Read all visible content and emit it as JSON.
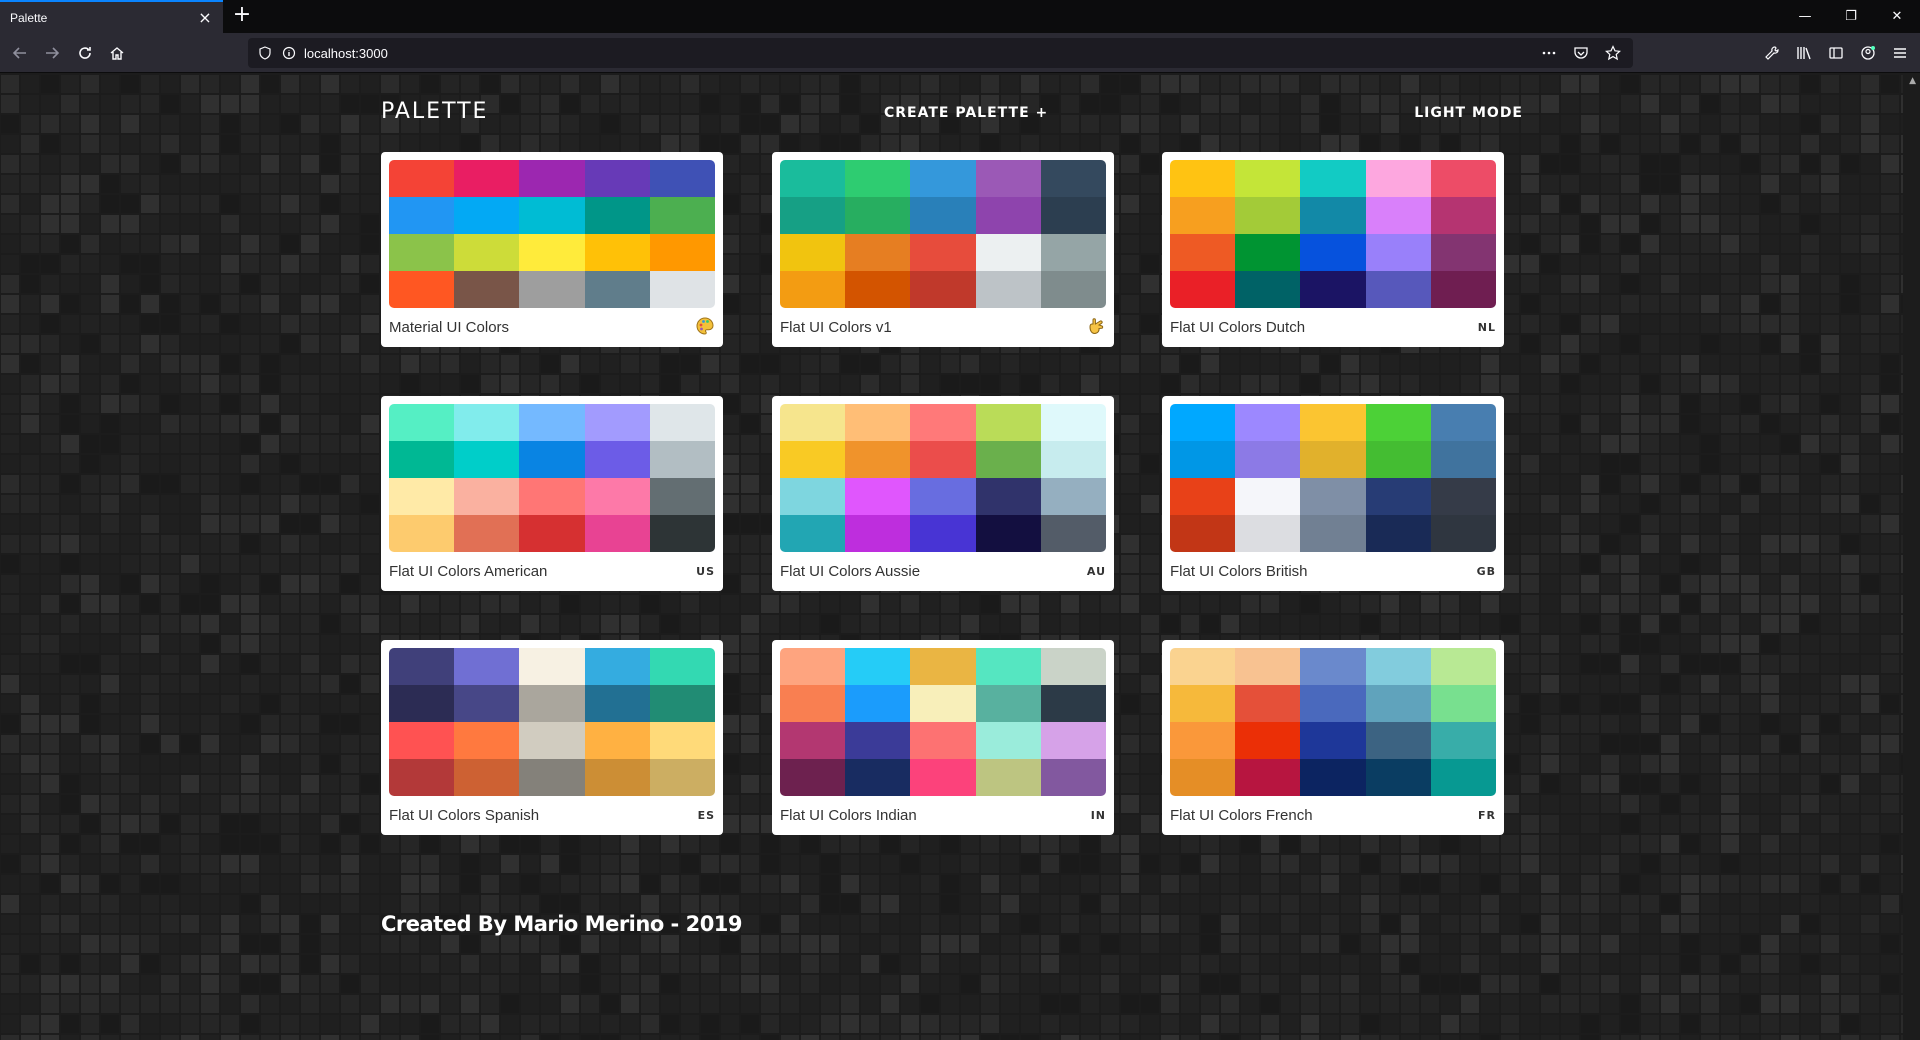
{
  "browser": {
    "tab_title": "Palette",
    "tab_close": "×",
    "new_tab": "+",
    "url": "localhost:3000",
    "window_controls": [
      "—",
      "❐",
      "✕"
    ]
  },
  "header": {
    "logo": "PALETTE",
    "create_link": "CREATE PALETTE +",
    "mode_link": "LIGHT MODE"
  },
  "palettes": [
    {
      "name": "Material UI Colors",
      "tag": "",
      "icon": "palette-emoji-icon",
      "colors": [
        "#f44336",
        "#e91e63",
        "#9c27b0",
        "#673ab7",
        "#3f51b5",
        "#2196f3",
        "#03a9f4",
        "#00bcd4",
        "#009688",
        "#4caf50",
        "#8bc34a",
        "#cddc39",
        "#ffeb3b",
        "#ffc107",
        "#ff9800",
        "#ff5722",
        "#795548",
        "#9e9e9e",
        "#607d8b",
        "#dfe3e6"
      ]
    },
    {
      "name": "Flat UI Colors v1",
      "tag": "",
      "icon": "hand-emoji-icon",
      "colors": [
        "#1abc9c",
        "#2ecc71",
        "#3498db",
        "#9b59b6",
        "#34495e",
        "#16a085",
        "#27ae60",
        "#2980b9",
        "#8e44ad",
        "#2c3e50",
        "#f1c40f",
        "#e67e22",
        "#e74c3c",
        "#ecf0f1",
        "#95a5a6",
        "#f39c12",
        "#d35400",
        "#c0392b",
        "#bdc3c7",
        "#7f8c8d"
      ]
    },
    {
      "name": "Flat UI Colors Dutch",
      "tag": "NL",
      "icon": "",
      "colors": [
        "#ffc312",
        "#c4e538",
        "#12cbc4",
        "#fda7df",
        "#ed4c67",
        "#f79f1f",
        "#a3cb38",
        "#1289a7",
        "#d980fa",
        "#b53471",
        "#ee5a24",
        "#009432",
        "#0652dd",
        "#9980fa",
        "#833471",
        "#ea2027",
        "#006266",
        "#1b1464",
        "#5758bb",
        "#6f1e51"
      ]
    },
    {
      "name": "Flat UI Colors American",
      "tag": "US",
      "icon": "",
      "colors": [
        "#55efc4",
        "#81ecec",
        "#74b9ff",
        "#a29bfe",
        "#dfe6e9",
        "#00b894",
        "#00cec9",
        "#0984e3",
        "#6c5ce7",
        "#b2bec3",
        "#ffeaa7",
        "#fab1a0",
        "#ff7675",
        "#fd79a8",
        "#636e72",
        "#fdcb6e",
        "#e17055",
        "#d63031",
        "#e84393",
        "#2d3436"
      ]
    },
    {
      "name": "Flat UI Colors Aussie",
      "tag": "AU",
      "icon": "",
      "colors": [
        "#f6e58d",
        "#ffbe76",
        "#ff7979",
        "#badc58",
        "#dff9fb",
        "#f9ca24",
        "#f0932b",
        "#eb4d4b",
        "#6ab04c",
        "#c7ecee",
        "#7ed6df",
        "#e056fd",
        "#686de0",
        "#30336b",
        "#95afc0",
        "#22a6b3",
        "#be2edd",
        "#4834d4",
        "#130f40",
        "#535c68"
      ]
    },
    {
      "name": "Flat UI Colors British",
      "tag": "GB",
      "icon": "",
      "colors": [
        "#00a8ff",
        "#9c88ff",
        "#fbc531",
        "#4cd137",
        "#487eb0",
        "#0097e6",
        "#8c7ae6",
        "#e1b12c",
        "#44bd32",
        "#40739e",
        "#e84118",
        "#f5f6fa",
        "#7f8fa6",
        "#273c75",
        "#353b48",
        "#c23616",
        "#dcdde1",
        "#718093",
        "#192a56",
        "#2f3640"
      ]
    },
    {
      "name": "Flat UI Colors Spanish",
      "tag": "ES",
      "icon": "",
      "colors": [
        "#40407a",
        "#706fd3",
        "#f7f1e3",
        "#34ace0",
        "#33d9b2",
        "#2c2c54",
        "#474787",
        "#aaa69d",
        "#227093",
        "#218c74",
        "#ff5252",
        "#ff793f",
        "#d1ccc0",
        "#ffb142",
        "#ffda79",
        "#b33939",
        "#cd6133",
        "#84817a",
        "#cc8e35",
        "#ccae62"
      ]
    },
    {
      "name": "Flat UI Colors Indian",
      "tag": "IN",
      "icon": "",
      "colors": [
        "#fea47f",
        "#25ccf7",
        "#eab543",
        "#55e6c1",
        "#cad3c8",
        "#f97f51",
        "#1b9cfc",
        "#f8efba",
        "#58b19f",
        "#2c3a47",
        "#b33771",
        "#3b3b98",
        "#fd7272",
        "#9aecdb",
        "#d6a2e8",
        "#6d214f",
        "#182c61",
        "#fc427b",
        "#bdc581",
        "#82589f"
      ]
    },
    {
      "name": "Flat UI Colors French",
      "tag": "FR",
      "icon": "",
      "colors": [
        "#fad390",
        "#f8c291",
        "#6a89cc",
        "#82ccdd",
        "#b8e994",
        "#f6b93b",
        "#e55039",
        "#4a69bd",
        "#60a3bc",
        "#78e08f",
        "#fa983a",
        "#eb2f06",
        "#1e3799",
        "#3c6382",
        "#38ada9",
        "#e58e26",
        "#b71540",
        "#0c2461",
        "#0a3d62",
        "#079992"
      ]
    }
  ],
  "footer": {
    "credit": "Created By Mario Merino - 2019"
  }
}
